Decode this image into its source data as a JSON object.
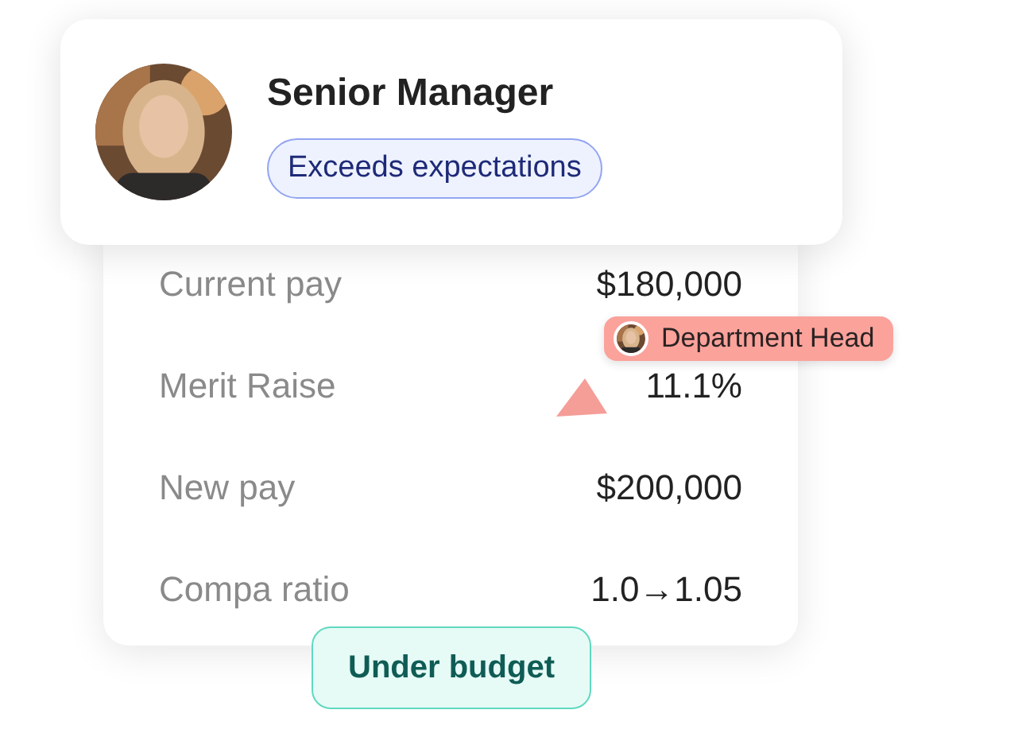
{
  "profile": {
    "title": "Senior Manager",
    "badge": "Exceeds expectations"
  },
  "rows": [
    {
      "label": "Current pay",
      "value": "$180,000"
    },
    {
      "label": "Merit Raise",
      "value": "11.1%"
    },
    {
      "label": "New pay",
      "value": "$200,000"
    },
    {
      "label": "Compa ratio",
      "value": "1.0→1.05"
    }
  ],
  "tag": {
    "label": "Department Head"
  },
  "status": {
    "label": "Under budget"
  }
}
